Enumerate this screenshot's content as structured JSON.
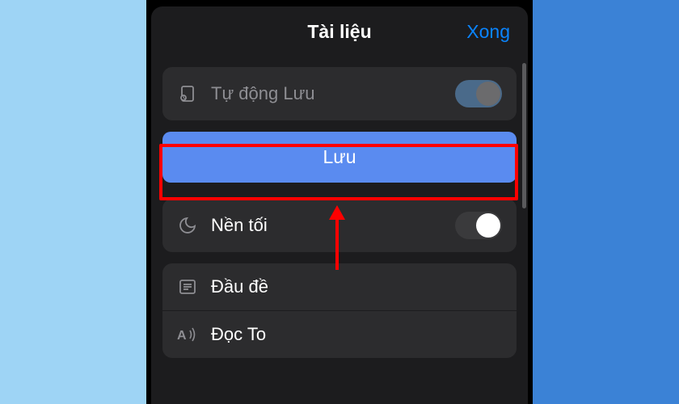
{
  "header": {
    "title": "Tài liệu",
    "done": "Xong"
  },
  "rows": {
    "autosave_label": "Tự động Lưu",
    "save_button": "Lưu",
    "darkmode_label": "Nền tối",
    "headings_label": "Đầu đề",
    "readaloud_label": "Đọc To"
  },
  "annotations": {
    "highlight": "save-button",
    "arrow_target": "save-button"
  }
}
